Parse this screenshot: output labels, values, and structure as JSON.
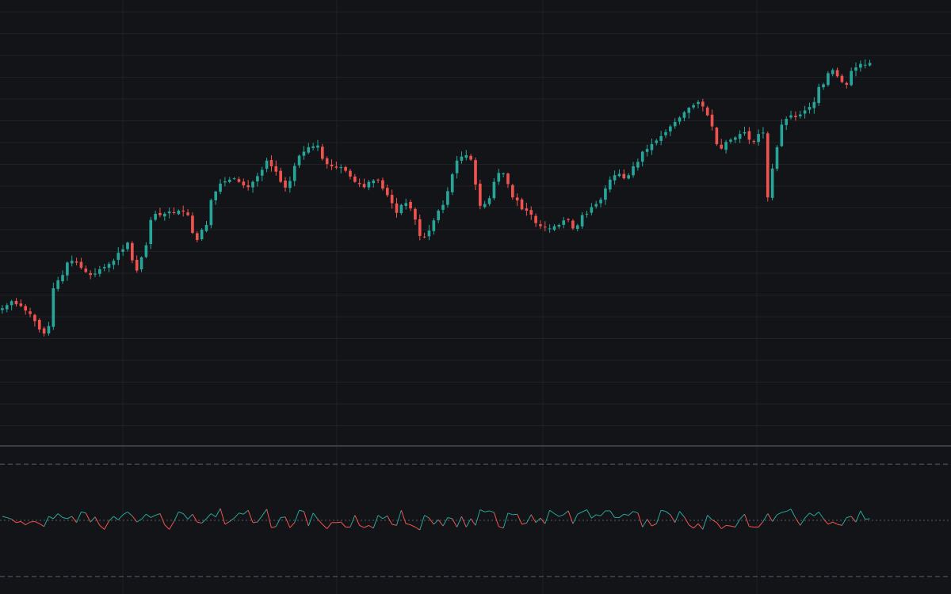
{
  "colors": {
    "background": "#131417",
    "grid": "#1f2126",
    "up": "#26a69a",
    "down": "#ef5350",
    "separator": "#3a3d44",
    "band": "#595d66"
  },
  "chart_data": [
    {
      "type": "candlestick",
      "title": "",
      "xlabel": "",
      "ylabel": "",
      "grid": true,
      "ylim": [
        0,
        100
      ],
      "x_range": [
        0,
        205
      ],
      "close": [
        30.5,
        31.2,
        32.1,
        31.4,
        31.0,
        30.0,
        29.2,
        27.6,
        25.7,
        24.8,
        26.5,
        35.0,
        36.8,
        38.0,
        40.8,
        41.2,
        40.8,
        39.6,
        38.7,
        38.0,
        38.3,
        39.3,
        39.8,
        40.5,
        41.2,
        43.0,
        43.8,
        45.3,
        41.3,
        39.0,
        42.0,
        44.7,
        50.4,
        51.8,
        51.5,
        51.8,
        52.3,
        52.0,
        52.5,
        52.3,
        51.5,
        47.5,
        45.9,
        48.2,
        49.3,
        54.9,
        56.8,
        58.6,
        59.1,
        59.5,
        59.8,
        59.0,
        58.2,
        57.8,
        59.0,
        60.3,
        61.7,
        63.8,
        62.5,
        61.3,
        59.0,
        57.7,
        59.2,
        62.6,
        64.9,
        65.8,
        66.8,
        67.0,
        67.2,
        64.2,
        63.0,
        62.5,
        62.2,
        62.3,
        61.5,
        60.2,
        59.0,
        58.5,
        57.8,
        59.0,
        59.3,
        59.5,
        57.5,
        56.0,
        54.2,
        52.0,
        53.8,
        54.2,
        53.0,
        50.5,
        46.8,
        46.6,
        48.0,
        50.3,
        52.5,
        53.8,
        56.9,
        60.7,
        63.8,
        64.7,
        65.0,
        64.0,
        58.4,
        53.6,
        54.0,
        55.3,
        59.0,
        61.0,
        60.9,
        58.5,
        55.5,
        54.8,
        52.8,
        52.5,
        51.6,
        49.7,
        49.0,
        48.7,
        48.5,
        49.0,
        49.3,
        50.3,
        50.5,
        48.5,
        49.2,
        51.5,
        51.8,
        53.3,
        54.0,
        55.0,
        57.5,
        59.5,
        60.5,
        60.8,
        59.8,
        60.5,
        62.5,
        63.5,
        65.8,
        66.4,
        67.5,
        68.3,
        69.3,
        70.2,
        71.5,
        72.5,
        73.5,
        74.7,
        75.7,
        76.3,
        77.0,
        76.0,
        74.0,
        71.5,
        67.5,
        66.5,
        68.0,
        68.5,
        69.0,
        69.8,
        70.2,
        68.5,
        68.0,
        69.8,
        70.1,
        55.5,
        62.0,
        66.8,
        71.9,
        73.2,
        74.0,
        73.6,
        74.2,
        75.1,
        75.9,
        77.0,
        80.4,
        81.0,
        83.5,
        84.2,
        82.8,
        81.5,
        80.9,
        84.0,
        84.8,
        85.6,
        85.4,
        85.8
      ],
      "bands": [
        -1,
        1
      ]
    },
    {
      "type": "line",
      "title": "",
      "xlabel": "",
      "ylabel": "",
      "ylim": [
        -1.2,
        1.2
      ],
      "x_range": [
        0,
        205
      ],
      "reference_lines": [
        -1,
        0,
        1
      ],
      "values": [
        0.07,
        0.05,
        0.02,
        -0.04,
        -0.02,
        -0.08,
        -0.03,
        -0.02,
        -0.06,
        -0.11,
        0.07,
        0.03,
        0.12,
        0.05,
        0.03,
        0.07,
        -0.04,
        0.15,
        0.13,
        -0.03,
        0.06,
        -0.09,
        -0.16,
        -0.01,
        0.07,
        0.01,
        0.1,
        0.15,
        0.08,
        -0.03,
        0.02,
        0.11,
        0.05,
        0.09,
        0.12,
        -0.08,
        -0.16,
        -0.02,
        0.15,
        0.12,
        0.02,
        0.11,
        -0.03,
        -0.05,
        0.03,
        0.12,
        0.06,
        0.21,
        -0.07,
        -0.02,
        0.04,
        0.13,
        0.11,
        0.18,
        -0.04,
        -0.03,
        0.08,
        0.2,
        -0.13,
        -0.11,
        0.05,
        0.06,
        -0.13,
        -0.04,
        0.18,
        0.16,
        -0.1,
        0.13,
        0.02,
        -0.07,
        -0.15,
        -0.04,
        -0.04,
        -0.03,
        -0.12,
        -0.12,
        0.09,
        -0.09,
        -0.13,
        -0.09,
        -0.14,
        0.09,
        0.03,
        0.08,
        -0.07,
        -0.09,
        0.18,
        -0.06,
        -0.08,
        -0.12,
        -0.17,
        0.09,
        0.04,
        -0.07,
        0.01,
        -0.1,
        0.05,
        0.03,
        -0.12,
        0.07,
        -0.12,
        0.03,
        -0.09,
        0.19,
        0.15,
        0.17,
        0.14,
        -0.11,
        -0.14,
        0.13,
        0.1,
        0.11,
        -0.07,
        -0.05,
        0.1,
        -0.04,
        0.04,
        -0.06,
        0.18,
        0.12,
        0.07,
        0.1,
        0.17,
        -0.06,
        0.11,
        0.15,
        0.19,
        0.04,
        0.1,
        0.08,
        0.17,
        0.17,
        0.05,
        0.05,
        0.11,
        0.09,
        0.16,
        0.13,
        -0.12,
        0.02,
        -0.1,
        -0.06,
        0.18,
        0.16,
        0.1,
        -0.04,
        0.16,
        0.06,
        -0.08,
        -0.14,
        -0.06,
        -0.16,
        0.09,
        0.01,
        -0.04,
        -0.15,
        -0.09,
        -0.1,
        -0.12,
        0.02,
        0.11,
        -0.11,
        -0.12,
        -0.12,
        -0.02,
        0.12,
        -0.02,
        0.1,
        0.14,
        0.16,
        0.2,
        0.04,
        -0.09,
        0.04,
        0.13,
        0.08,
        0.15,
        0.03,
        -0.07,
        -0.03,
        -0.07,
        -0.09,
        0.05,
        0.07,
        -0.03,
        0.17,
        0.02,
        0.03
      ]
    }
  ]
}
